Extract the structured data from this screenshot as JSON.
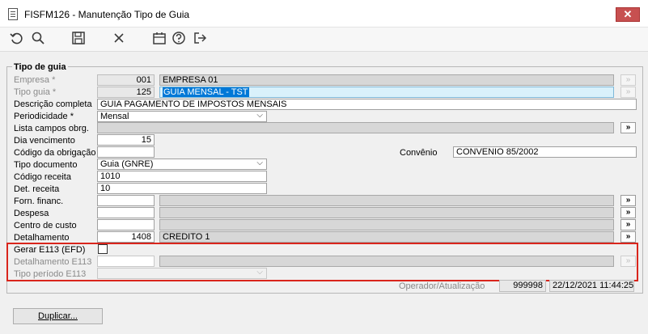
{
  "window": {
    "title": "FISFM126 - Manutenção Tipo de Guia",
    "close_glyph": "✕"
  },
  "toolbar": {
    "icons": [
      "undo-icon",
      "search-icon",
      "save-icon",
      "delete-icon",
      "calendar-icon",
      "help-icon",
      "exit-icon"
    ]
  },
  "group": {
    "label": "Tipo de guia"
  },
  "fields": {
    "empresa": {
      "label": "Empresa *",
      "code": "001",
      "desc": "EMPRESA 01"
    },
    "tipo_guia": {
      "label": "Tipo guia *",
      "code": "125",
      "desc": "GUIA MENSAL - TST"
    },
    "descricao": {
      "label": "Descrição completa",
      "value": "GUIA PAGAMENTO DE IMPOSTOS MENSAIS"
    },
    "periodicidade": {
      "label": "Periodicidade *",
      "value": "Mensal"
    },
    "lista_campos": {
      "label": "Lista campos obrg.",
      "value": ""
    },
    "dia_vencimento": {
      "label": "Dia vencimento",
      "value": "15"
    },
    "codigo_obrigacao": {
      "label": "Código da obrigação",
      "value": ""
    },
    "convenio": {
      "label": "Convênio",
      "value": "CONVENIO 85/2002"
    },
    "tipo_documento": {
      "label": "Tipo documento",
      "value": "Guia (GNRE)"
    },
    "codigo_receita": {
      "label": "Código receita",
      "value": "1010"
    },
    "det_receita": {
      "label": "Det. receita",
      "value": "10"
    },
    "forn_financ": {
      "label": "Forn. financ.",
      "code": "",
      "desc": ""
    },
    "despesa": {
      "label": "Despesa",
      "code": "",
      "desc": ""
    },
    "centro_custo": {
      "label": "Centro de custo",
      "code": "",
      "desc": ""
    },
    "detalhamento": {
      "label": "Detalhamento",
      "code": "1408",
      "desc": "CREDITO 1"
    },
    "gerar_e113": {
      "label": "Gerar E113 (EFD)",
      "checked": false
    },
    "detalhamento_e113": {
      "label": "Detalhamento E113",
      "code": "",
      "desc": ""
    },
    "tipo_periodo_e113": {
      "label": "Tipo período E113",
      "value": ""
    },
    "operador": {
      "label": "Operador/Atualização",
      "code": "999998",
      "datetime": "22/12/2021 11:44:25"
    }
  },
  "buttons": {
    "more": "»",
    "duplicar": "Duplicar..."
  }
}
